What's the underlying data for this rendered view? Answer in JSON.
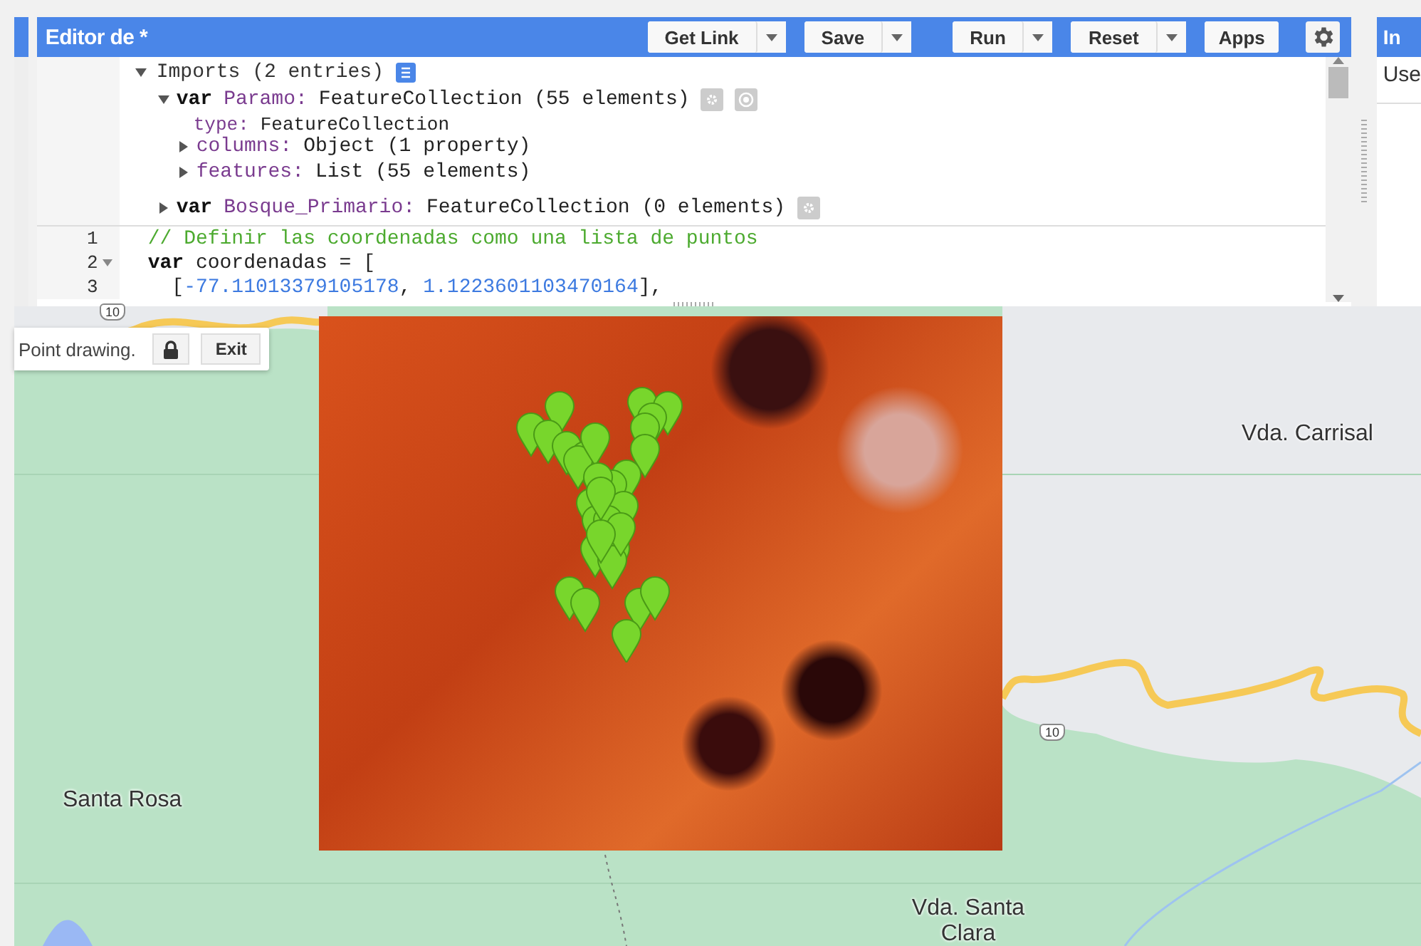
{
  "editor": {
    "title": "Editor de *",
    "buttons": [
      {
        "label": "Get Link",
        "dropdown": true
      },
      {
        "label": "Save",
        "dropdown": true
      },
      {
        "label": "Run",
        "dropdown": true
      },
      {
        "label": "Reset",
        "dropdown": true
      },
      {
        "label": "Apps",
        "dropdown": false
      }
    ],
    "imports": {
      "summary": "Imports (2 entries)",
      "expanded": true,
      "items": [
        {
          "keyword": "var",
          "name": "Paramo:",
          "type": "FeatureCollection (55 elements)",
          "expanded": true,
          "layer_icon": true,
          "children": [
            {
              "key": "type:",
              "value": "FeatureCollection",
              "expandable": false
            },
            {
              "key": "columns:",
              "value": "Object (1 property)",
              "expandable": true
            },
            {
              "key": "features:",
              "value": "List (55 elements)",
              "expandable": true
            }
          ]
        },
        {
          "keyword": "var",
          "name": "Bosque_Primario:",
          "type": "FeatureCollection (0 elements)",
          "expanded": false,
          "layer_icon": false
        }
      ]
    },
    "code": [
      {
        "number": "1",
        "foldable": false,
        "tokens": [
          {
            "text": "// Definir las coordenadas como una lista de puntos",
            "kind": "comment"
          }
        ]
      },
      {
        "number": "2",
        "foldable": true,
        "tokens": [
          {
            "text": "var",
            "kind": "keyword"
          },
          {
            "text": " coordenadas = [",
            "kind": "plain"
          }
        ]
      },
      {
        "number": "3",
        "foldable": false,
        "tokens": [
          {
            "text": "  [",
            "kind": "plain"
          },
          {
            "text": "-77.11013379105178",
            "kind": "number"
          },
          {
            "text": ", ",
            "kind": "plain"
          },
          {
            "text": "1.1223601103470164",
            "kind": "number"
          },
          {
            "text": "],",
            "kind": "plain"
          }
        ]
      }
    ]
  },
  "inspector": {
    "tab": "In",
    "text": "Use"
  },
  "map": {
    "toolbar": {
      "label": "Point drawing.",
      "exit": "Exit"
    },
    "route_shields": [
      "10",
      "10"
    ],
    "labels": [
      "Vda. Carrisal",
      "Santa Rosa",
      "Vda. Santa Clara"
    ]
  }
}
